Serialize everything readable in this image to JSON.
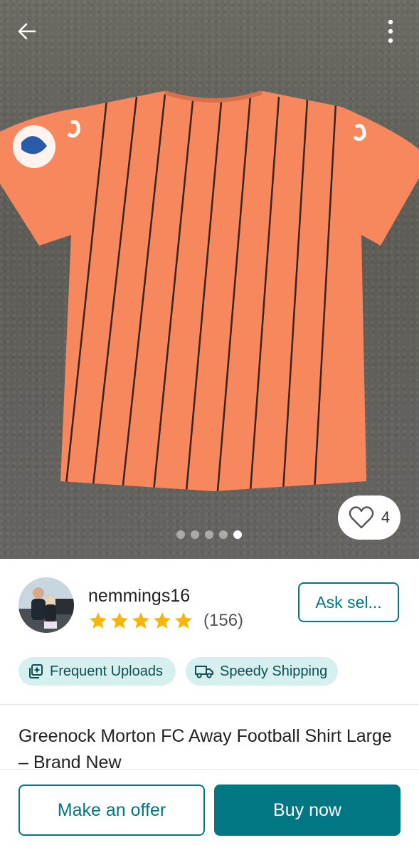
{
  "listing": {
    "like_count": "4",
    "image_count": 5,
    "active_image": 5,
    "title": "Greenock Morton FC Away Football Shirt Large – Brand New"
  },
  "seller": {
    "username": "nemmings16",
    "rating_stars": 5,
    "review_count": "(156)",
    "ask_label": "Ask sel..."
  },
  "badges": [
    {
      "label": "Frequent Uploads",
      "icon": "upload-gallery-icon"
    },
    {
      "label": "Speedy Shipping",
      "icon": "truck-icon"
    }
  ],
  "actions": {
    "offer_label": "Make an offer",
    "buy_label": "Buy now"
  },
  "colors": {
    "accent": "#007782",
    "badge_bg": "#d5f0ee",
    "star": "#f5b50a",
    "shirt": "#f7875d"
  }
}
